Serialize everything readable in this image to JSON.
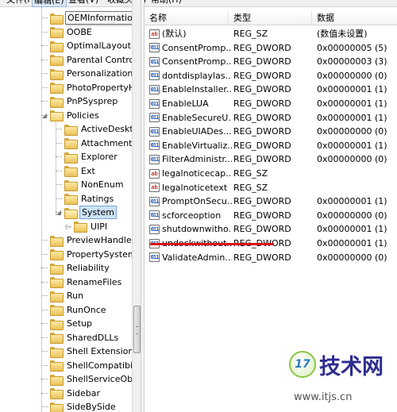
{
  "menu": [
    "文件(F)",
    "编辑(E)",
    "查看(V)",
    "收藏夹(A)",
    "帮助(H)"
  ],
  "tooltip": "OEMInformation",
  "tree": [
    {
      "label": "OEMInformation",
      "level": 0
    },
    {
      "label": "OOBE",
      "level": 0
    },
    {
      "label": "OptimalLayout",
      "level": 0
    },
    {
      "label": "Parental Controls",
      "level": 0
    },
    {
      "label": "Personalization",
      "level": 0
    },
    {
      "label": "PhotoPropertyHandler",
      "level": 0
    },
    {
      "label": "PnPSysprep",
      "level": 0
    },
    {
      "label": "Policies",
      "level": 0,
      "expanded": true
    },
    {
      "label": "ActiveDesktop",
      "level": 1
    },
    {
      "label": "Attachments",
      "level": 1
    },
    {
      "label": "Explorer",
      "level": 1
    },
    {
      "label": "Ext",
      "level": 1
    },
    {
      "label": "NonEnum",
      "level": 1
    },
    {
      "label": "Ratings",
      "level": 1
    },
    {
      "label": "System",
      "level": 1,
      "expanded": true,
      "selected": true
    },
    {
      "label": "UIPI",
      "level": 2
    },
    {
      "label": "PreviewHandlers",
      "level": 0
    },
    {
      "label": "PropertySystem",
      "level": 0
    },
    {
      "label": "Reliability",
      "level": 0
    },
    {
      "label": "RenameFiles",
      "level": 0
    },
    {
      "label": "Run",
      "level": 0
    },
    {
      "label": "RunOnce",
      "level": 0
    },
    {
      "label": "Setup",
      "level": 0
    },
    {
      "label": "SharedDLLs",
      "level": 0
    },
    {
      "label": "Shell Extensions",
      "level": 0
    },
    {
      "label": "ShellCompatibility",
      "level": 0
    },
    {
      "label": "ShellServiceObjects",
      "level": 0
    },
    {
      "label": "Sidebar",
      "level": 0
    },
    {
      "label": "SideBySide",
      "level": 0
    }
  ],
  "columns": {
    "name": "名称",
    "type": "类型",
    "data": "数据"
  },
  "values": [
    {
      "icon": "ab",
      "name": "(默认)",
      "type": "REG_SZ",
      "data": "(数值未设置)"
    },
    {
      "icon": "dword",
      "name": "ConsentPromp...",
      "type": "REG_DWORD",
      "data": "0x00000005 (5)"
    },
    {
      "icon": "dword",
      "name": "ConsentPromp...",
      "type": "REG_DWORD",
      "data": "0x00000003 (3)"
    },
    {
      "icon": "dword",
      "name": "dontdisplaylas...",
      "type": "REG_DWORD",
      "data": "0x00000000 (0)"
    },
    {
      "icon": "dword",
      "name": "EnableInstaller...",
      "type": "REG_DWORD",
      "data": "0x00000001 (1)"
    },
    {
      "icon": "dword",
      "name": "EnableLUA",
      "type": "REG_DWORD",
      "data": "0x00000001 (1)"
    },
    {
      "icon": "dword",
      "name": "EnableSecureU...",
      "type": "REG_DWORD",
      "data": "0x00000001 (1)"
    },
    {
      "icon": "dword",
      "name": "EnableUIADes...",
      "type": "REG_DWORD",
      "data": "0x00000000 (0)"
    },
    {
      "icon": "dword",
      "name": "EnableVirtualiz...",
      "type": "REG_DWORD",
      "data": "0x00000001 (1)"
    },
    {
      "icon": "dword",
      "name": "FilterAdministr...",
      "type": "REG_DWORD",
      "data": "0x00000000 (0)"
    },
    {
      "icon": "ab",
      "name": "legalnoticecap...",
      "type": "REG_SZ",
      "data": ""
    },
    {
      "icon": "ab",
      "name": "legalnoticetext",
      "type": "REG_SZ",
      "data": ""
    },
    {
      "icon": "dword",
      "name": "PromptOnSecu...",
      "type": "REG_DWORD",
      "data": "0x00000001 (1)"
    },
    {
      "icon": "dword",
      "name": "scforceoption",
      "type": "REG_DWORD",
      "data": "0x00000000 (0)"
    },
    {
      "icon": "dword",
      "name": "shutdownwitho...",
      "type": "REG_DWORD",
      "data": "0x00000001 (1)",
      "highlight": true
    },
    {
      "icon": "dword",
      "name": "undockwithout...",
      "type": "REG_DWORD",
      "data": "0x00000001 (1)"
    },
    {
      "icon": "dword",
      "name": "ValidateAdmin...",
      "type": "REG_DWORD",
      "data": "0x00000000 (0)"
    }
  ],
  "icon_glyphs": {
    "ab": "ab",
    "dword": "011"
  },
  "watermark": {
    "badge": "17",
    "title": "技术网",
    "url": "www.itjs.cn"
  },
  "colors": {
    "highlight_line": "#d8141b",
    "selection": "#cde3f7",
    "folder": "#f3cf6b"
  }
}
